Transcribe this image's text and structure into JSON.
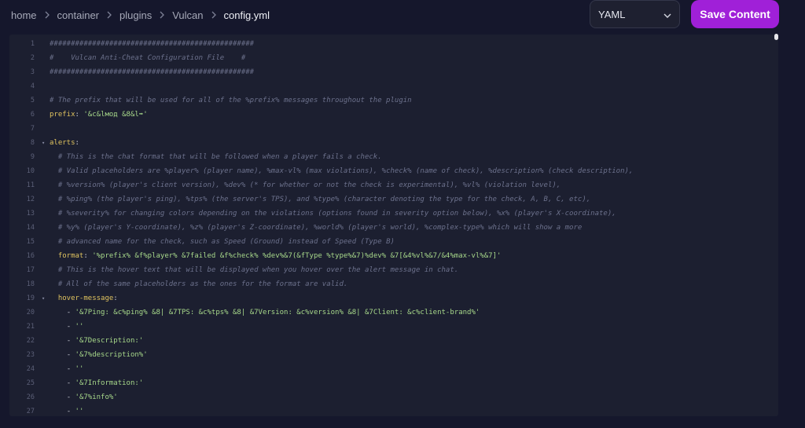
{
  "breadcrumb": {
    "items": [
      "home",
      "container",
      "plugins",
      "Vulcan",
      "config.yml"
    ]
  },
  "language_select": {
    "value": "YAML"
  },
  "save_button": {
    "label": "Save Content"
  },
  "colors": {
    "accent": "#a020d8",
    "background": "#15172c",
    "editor_bg": "#1c1f30",
    "comment": "#6c718c",
    "key": "#e0c35f",
    "string": "#a7d88a"
  },
  "code_lines": [
    {
      "n": "1",
      "indent": "",
      "parts": [
        {
          "t": "comment",
          "v": "################################################"
        }
      ]
    },
    {
      "n": "2",
      "indent": "",
      "parts": [
        {
          "t": "comment",
          "v": "#    Vulcan Anti-Cheat Configuration File    #"
        }
      ]
    },
    {
      "n": "3",
      "indent": "",
      "parts": [
        {
          "t": "comment",
          "v": "################################################"
        }
      ]
    },
    {
      "n": "4",
      "indent": "",
      "parts": []
    },
    {
      "n": "5",
      "indent": "",
      "parts": [
        {
          "t": "comment",
          "v": "# The prefix that will be used for all of the %prefix% messages throughout the plugin"
        }
      ]
    },
    {
      "n": "6",
      "indent": "",
      "parts": [
        {
          "t": "key",
          "v": "prefix"
        },
        {
          "t": "punct",
          "v": ": "
        },
        {
          "t": "str",
          "v": "'&c&lмод &8&l➡'"
        }
      ]
    },
    {
      "n": "7",
      "indent": "",
      "parts": []
    },
    {
      "n": "8",
      "indent": "",
      "fold": true,
      "parts": [
        {
          "t": "key",
          "v": "alerts"
        },
        {
          "t": "punct",
          "v": ":"
        }
      ]
    },
    {
      "n": "9",
      "indent": "  ",
      "parts": [
        {
          "t": "comment",
          "v": "# This is the chat format that will be followed when a player fails a check."
        }
      ]
    },
    {
      "n": "10",
      "indent": "  ",
      "parts": [
        {
          "t": "comment",
          "v": "# Valid placeholders are %player% (player name), %max-vl% (max violations), %check% (name of check), %description% (check description),"
        }
      ]
    },
    {
      "n": "11",
      "indent": "  ",
      "parts": [
        {
          "t": "comment",
          "v": "# %version% (player's client version), %dev% (* for whether or not the check is experimental), %vl% (violation level),"
        }
      ]
    },
    {
      "n": "12",
      "indent": "  ",
      "parts": [
        {
          "t": "comment",
          "v": "# %ping% (the player's ping), %tps% (the server's TPS), and %type% (character denoting the type for the check, A, B, C, etc),"
        }
      ]
    },
    {
      "n": "13",
      "indent": "  ",
      "parts": [
        {
          "t": "comment",
          "v": "# %severity% for changing colors depending on the violations (options found in severity option below), %x% (player's X-coordinate),"
        }
      ]
    },
    {
      "n": "14",
      "indent": "  ",
      "parts": [
        {
          "t": "comment",
          "v": "# %y% (player's Y-coordinate), %z% (player's Z-coordinate), %world% (player's world), %complex-type% which will show a more"
        }
      ]
    },
    {
      "n": "15",
      "indent": "  ",
      "parts": [
        {
          "t": "comment",
          "v": "# advanced name for the check, such as Speed (Ground) instead of Speed (Type B)"
        }
      ]
    },
    {
      "n": "16",
      "indent": "  ",
      "parts": [
        {
          "t": "key",
          "v": "format"
        },
        {
          "t": "punct",
          "v": ": "
        },
        {
          "t": "str",
          "v": "'%prefix% &f%player% &7failed &f%check% %dev%&7(&fType %type%&7)%dev% &7[&4%vl%&7/&4%max-vl%&7]'"
        }
      ]
    },
    {
      "n": "17",
      "indent": "  ",
      "parts": [
        {
          "t": "comment",
          "v": "# This is the hover text that will be displayed when you hover over the alert message in chat."
        }
      ]
    },
    {
      "n": "18",
      "indent": "  ",
      "parts": [
        {
          "t": "comment",
          "v": "# All of the same placeholders as the ones for the format are valid."
        }
      ]
    },
    {
      "n": "19",
      "indent": "  ",
      "fold": true,
      "parts": [
        {
          "t": "key",
          "v": "hover-message"
        },
        {
          "t": "punct",
          "v": ":"
        }
      ]
    },
    {
      "n": "20",
      "indent": "    ",
      "parts": [
        {
          "t": "punct",
          "v": "- "
        },
        {
          "t": "str",
          "v": "'&7Ping: &c%ping% &8| &7TPS: &c%tps% &8| &7Version: &c%version% &8| &7Client: &c%client-brand%'"
        }
      ]
    },
    {
      "n": "21",
      "indent": "    ",
      "parts": [
        {
          "t": "punct",
          "v": "- "
        },
        {
          "t": "str",
          "v": "''"
        }
      ]
    },
    {
      "n": "22",
      "indent": "    ",
      "parts": [
        {
          "t": "punct",
          "v": "- "
        },
        {
          "t": "str",
          "v": "'&7Description:'"
        }
      ]
    },
    {
      "n": "23",
      "indent": "    ",
      "parts": [
        {
          "t": "punct",
          "v": "- "
        },
        {
          "t": "str",
          "v": "'&7%description%'"
        }
      ]
    },
    {
      "n": "24",
      "indent": "    ",
      "parts": [
        {
          "t": "punct",
          "v": "- "
        },
        {
          "t": "str",
          "v": "''"
        }
      ]
    },
    {
      "n": "25",
      "indent": "    ",
      "parts": [
        {
          "t": "punct",
          "v": "- "
        },
        {
          "t": "str",
          "v": "'&7Information:'"
        }
      ]
    },
    {
      "n": "26",
      "indent": "    ",
      "parts": [
        {
          "t": "punct",
          "v": "- "
        },
        {
          "t": "str",
          "v": "'&7%info%'"
        }
      ]
    },
    {
      "n": "27",
      "indent": "    ",
      "parts": [
        {
          "t": "punct",
          "v": "- "
        },
        {
          "t": "str",
          "v": "''"
        }
      ]
    }
  ]
}
